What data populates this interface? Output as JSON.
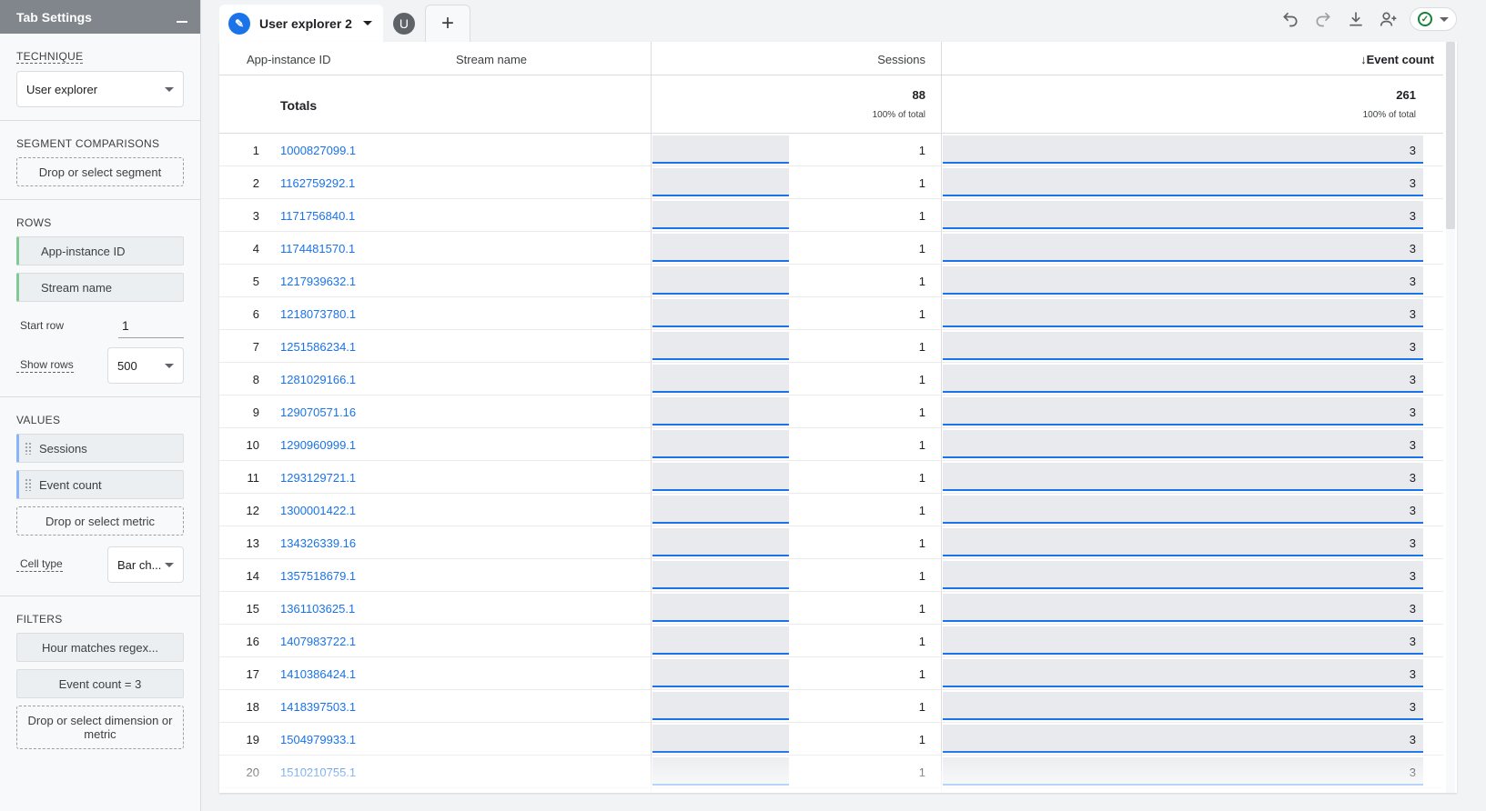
{
  "panel": {
    "title": "Tab Settings",
    "technique": {
      "label": "TECHNIQUE",
      "value": "User explorer"
    },
    "segments": {
      "label": "SEGMENT COMPARISONS",
      "drop": "Drop or select segment"
    },
    "rows": {
      "label": "ROWS",
      "items": [
        "App-instance ID",
        "Stream name"
      ],
      "start_row_label": "Start row",
      "start_row_value": "1",
      "show_rows_label": "Show rows",
      "show_rows_value": "500"
    },
    "values": {
      "label": "VALUES",
      "items": [
        "Sessions",
        "Event count"
      ],
      "drop": "Drop or select metric",
      "cell_type_label": "Cell type",
      "cell_type_value": "Bar ch..."
    },
    "filters": {
      "label": "FILTERS",
      "items": [
        "Hour matches regex...",
        "Event count = 3"
      ],
      "drop": "Drop or select dimension or metric"
    }
  },
  "tabs": {
    "active_label": "User explorer 2",
    "avatar_letter": "U",
    "add_symbol": "+"
  },
  "toolbar": {
    "icons": [
      "undo-icon",
      "redo-icon",
      "download-icon",
      "share-user-icon",
      "check-circle-icon"
    ]
  },
  "table": {
    "headers": {
      "app_id": "App-instance ID",
      "stream": "Stream name",
      "sessions": "Sessions",
      "events": "Event count",
      "sort_arrow": "↓"
    },
    "totals": {
      "label": "Totals",
      "sessions": "88",
      "sessions_pct": "100% of total",
      "events": "261",
      "events_pct": "100% of total"
    },
    "rows": [
      {
        "idx": "1",
        "id": "1000827099.1",
        "sessions": "1",
        "events": "3"
      },
      {
        "idx": "2",
        "id": "1162759292.1",
        "sessions": "1",
        "events": "3"
      },
      {
        "idx": "3",
        "id": "1171756840.1",
        "sessions": "1",
        "events": "3"
      },
      {
        "idx": "4",
        "id": "1174481570.1",
        "sessions": "1",
        "events": "3"
      },
      {
        "idx": "5",
        "id": "1217939632.1",
        "sessions": "1",
        "events": "3"
      },
      {
        "idx": "6",
        "id": "1218073780.1",
        "sessions": "1",
        "events": "3"
      },
      {
        "idx": "7",
        "id": "1251586234.1",
        "sessions": "1",
        "events": "3"
      },
      {
        "idx": "8",
        "id": "1281029166.1",
        "sessions": "1",
        "events": "3"
      },
      {
        "idx": "9",
        "id": "129070571.16",
        "sessions": "1",
        "events": "3"
      },
      {
        "idx": "10",
        "id": "1290960999.1",
        "sessions": "1",
        "events": "3"
      },
      {
        "idx": "11",
        "id": "1293129721.1",
        "sessions": "1",
        "events": "3"
      },
      {
        "idx": "12",
        "id": "1300001422.1",
        "sessions": "1",
        "events": "3"
      },
      {
        "idx": "13",
        "id": "134326339.16",
        "sessions": "1",
        "events": "3"
      },
      {
        "idx": "14",
        "id": "1357518679.1",
        "sessions": "1",
        "events": "3"
      },
      {
        "idx": "15",
        "id": "1361103625.1",
        "sessions": "1",
        "events": "3"
      },
      {
        "idx": "16",
        "id": "1407983722.1",
        "sessions": "1",
        "events": "3"
      },
      {
        "idx": "17",
        "id": "1410386424.1",
        "sessions": "1",
        "events": "3"
      },
      {
        "idx": "18",
        "id": "1418397503.1",
        "sessions": "1",
        "events": "3"
      },
      {
        "idx": "19",
        "id": "1504979933.1",
        "sessions": "1",
        "events": "3"
      },
      {
        "idx": "20",
        "id": "1510210755.1",
        "sessions": "1",
        "events": "3"
      }
    ]
  },
  "colors": {
    "accent": "#1a73e8",
    "row_chip": "#81c995",
    "value_chip": "#8ab4f8",
    "bar_fill": "#e8eaed"
  }
}
